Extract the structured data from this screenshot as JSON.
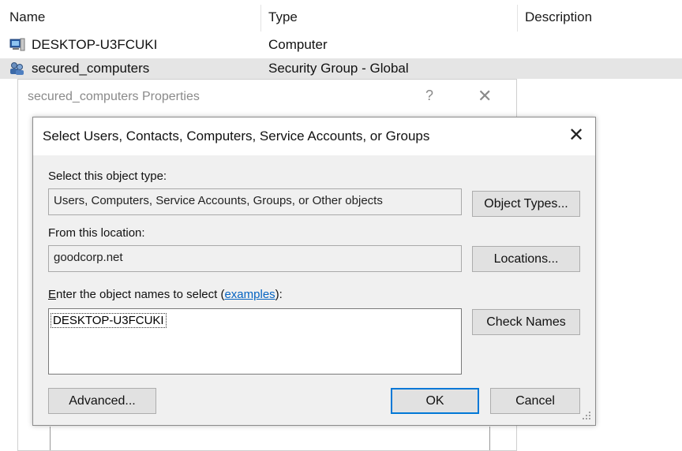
{
  "list": {
    "columns": [
      "Name",
      "Type",
      "Description"
    ],
    "rows": [
      {
        "name": "DESKTOP-U3FCUKI",
        "type": "Computer",
        "icon": "computer-icon"
      },
      {
        "name": "secured_computers",
        "type": "Security Group - Global",
        "icon": "group-icon"
      }
    ]
  },
  "properties": {
    "title": "secured_computers Properties",
    "help": "?",
    "close": "✕"
  },
  "dialog": {
    "title": "Select Users, Contacts, Computers, Service Accounts, or Groups",
    "close": "✕",
    "object_type_label": "Select this object type:",
    "object_type_value": "Users, Computers, Service Accounts, Groups, or Other objects",
    "object_types_button": "Object Types...",
    "location_label": "From this location:",
    "location_value": "goodcorp.net",
    "locations_button": "Locations...",
    "names_label_first": "E",
    "names_label_rest": "nter the object names to select (",
    "examples_link": "examples",
    "names_label_end": "):",
    "names_value": "DESKTOP-U3FCUKI",
    "check_names_button": "Check Names",
    "advanced_button": "Advanced...",
    "ok_button": "OK",
    "cancel_button": "Cancel"
  },
  "colors": {
    "selection": "#e5e5e5",
    "dialog_bg": "#f0f0f0",
    "accent": "#0078d7",
    "link": "#0563c1"
  }
}
